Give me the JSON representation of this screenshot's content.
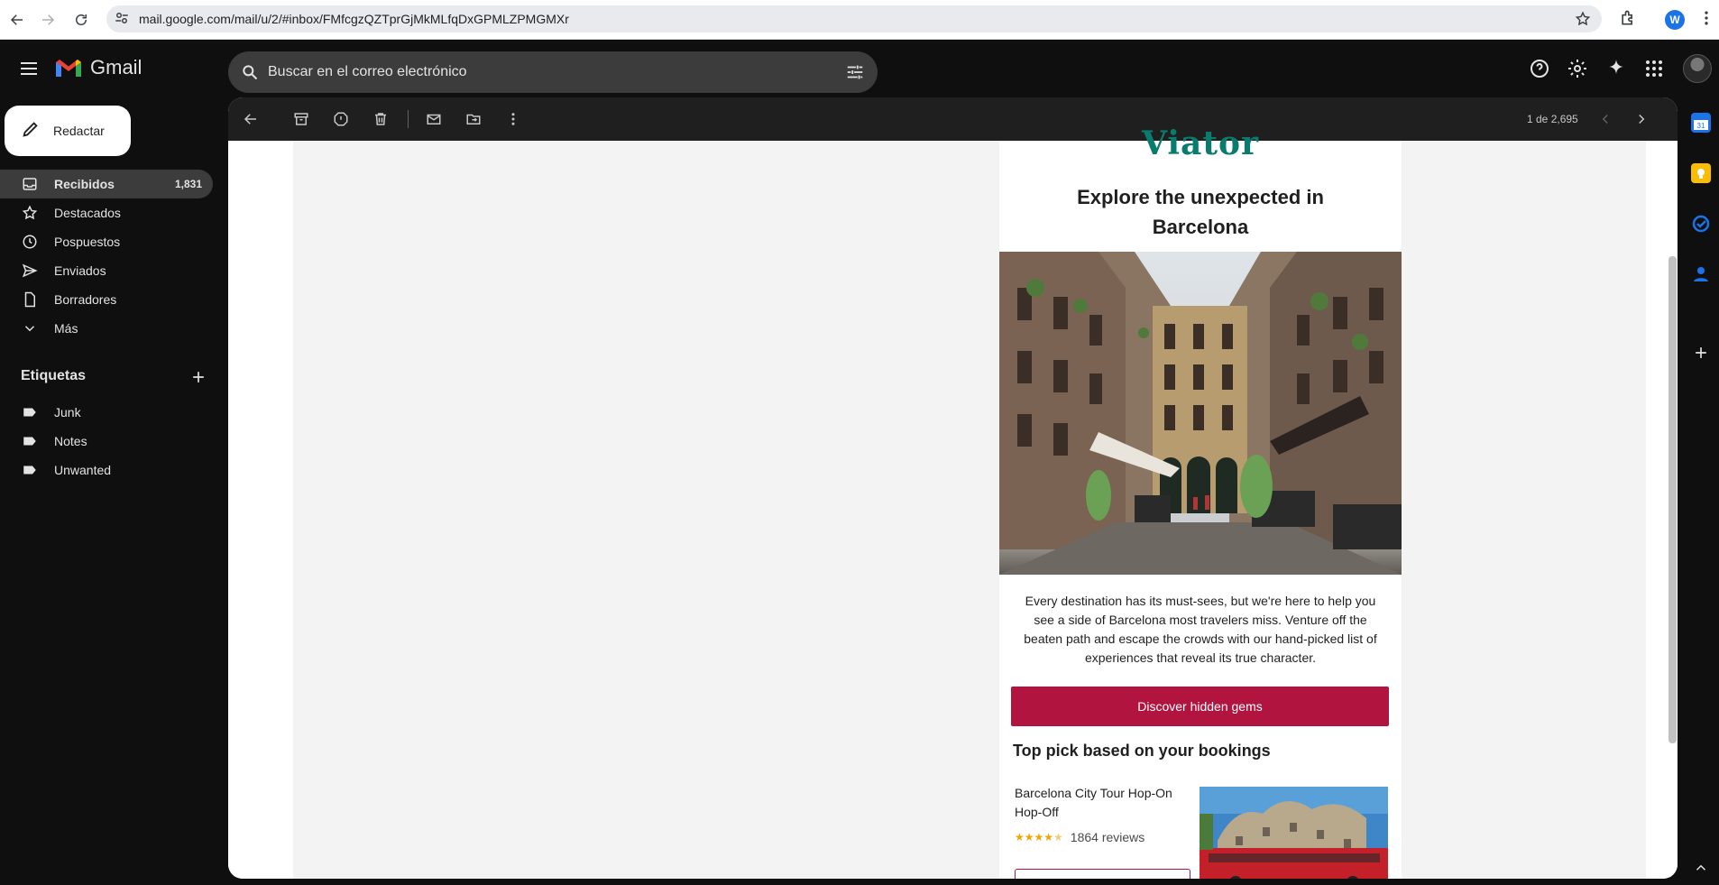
{
  "browser": {
    "url": "mail.google.com/mail/u/2/#inbox/FMfcgzQZTprGjMkMLfqDxGPMLZPMGMXr",
    "profile_initial": "W"
  },
  "header": {
    "app_name": "Gmail",
    "search_placeholder": "Buscar en el correo electrónico"
  },
  "sidebar": {
    "compose_label": "Redactar",
    "items": [
      {
        "label": "Recibidos",
        "count": "1,831",
        "icon": "inbox-icon"
      },
      {
        "label": "Destacados",
        "icon": "star-icon"
      },
      {
        "label": "Pospuestos",
        "icon": "clock-icon"
      },
      {
        "label": "Enviados",
        "icon": "send-icon"
      },
      {
        "label": "Borradores",
        "icon": "draft-icon"
      },
      {
        "label": "Más",
        "icon": "chevron-down-icon"
      }
    ],
    "labels_title": "Etiquetas",
    "labels": [
      {
        "label": "Junk"
      },
      {
        "label": "Notes"
      },
      {
        "label": "Unwanted"
      }
    ]
  },
  "toolbar": {
    "pager": "1 de 2,695"
  },
  "email": {
    "brand": "Viator",
    "headline": "Explore the unexpected in Barcelona",
    "body": "Every destination has its must-sees, but we're here to help you see a side of Barcelona most travelers miss. Venture off the beaten path and escape the crowds with our hand-picked list of experiences that reveal its true character.",
    "cta_label": "Discover hidden gems",
    "section_title": "Top pick based on your bookings",
    "tour": {
      "name": "Barcelona City Tour Hop-On Hop-Off",
      "rating": 4.5,
      "reviews": "1864 reviews"
    }
  },
  "colors": {
    "cta": "#b0143f",
    "brand": "#0a7c6e",
    "stars": "#f0a500",
    "dark_bg": "#0f0f0f"
  }
}
